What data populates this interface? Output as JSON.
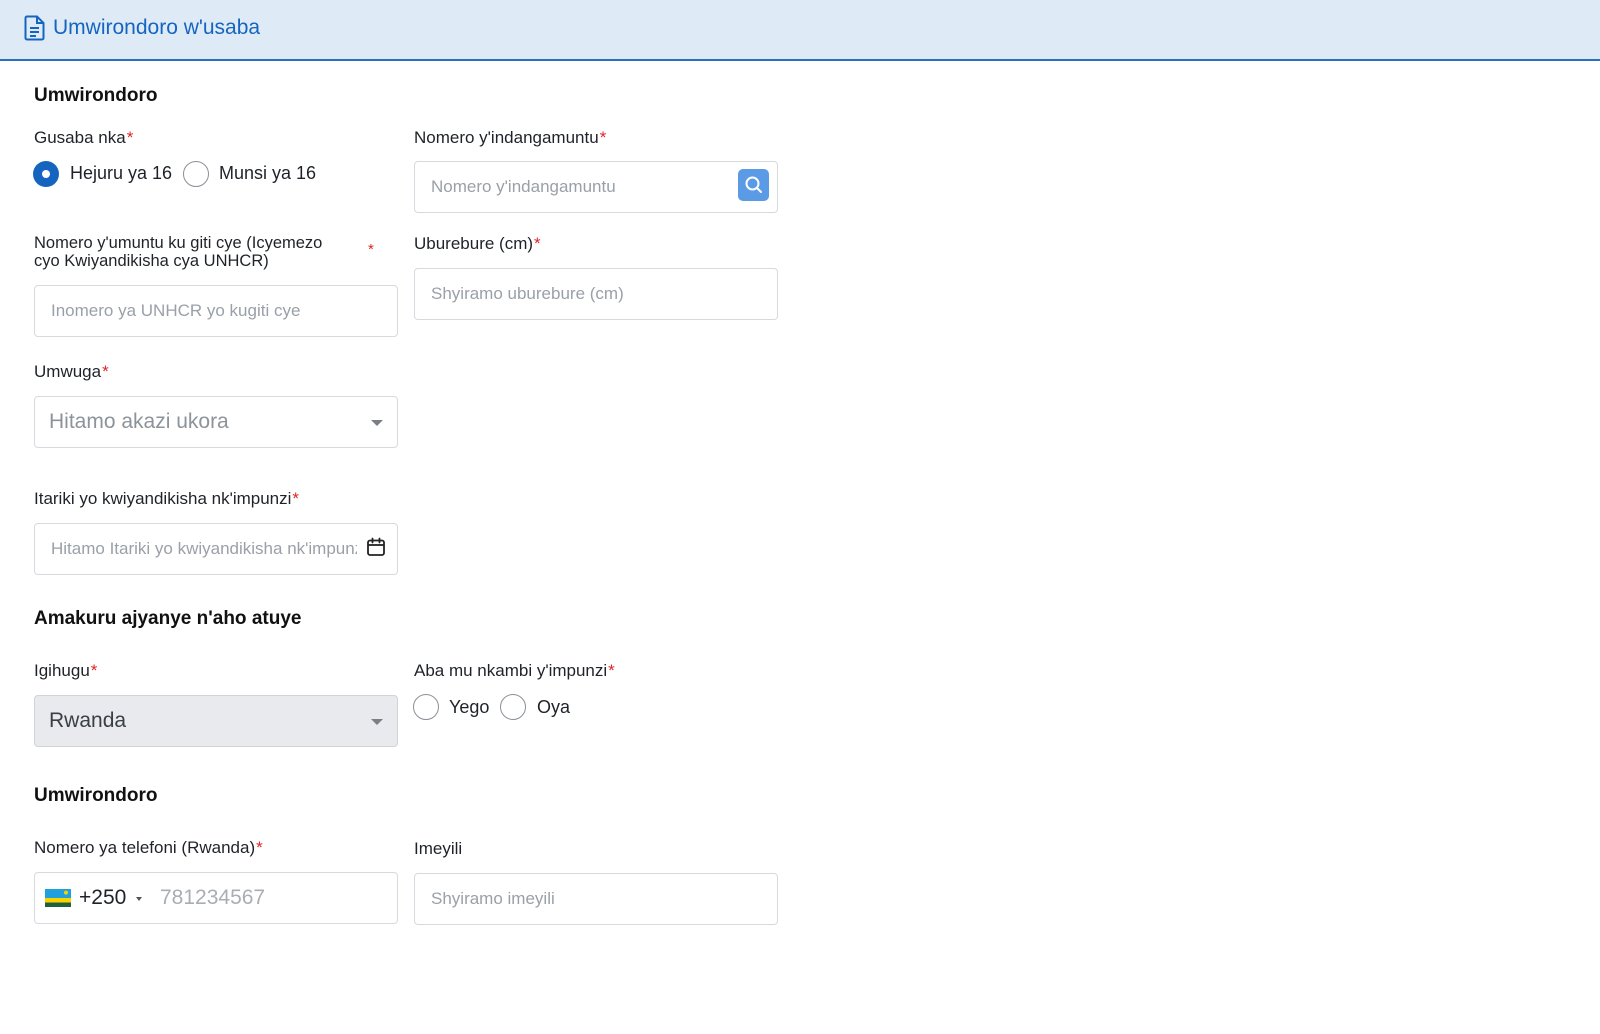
{
  "header": {
    "title": "Umwirondoro w'usaba",
    "icon": "document-icon"
  },
  "profile_section": {
    "title": "Umwirondoro",
    "applicant_type": {
      "label": "Gusaba nka",
      "required": "*",
      "options": [
        {
          "label": "Hejuru ya 16",
          "checked": true
        },
        {
          "label": "Munsi ya 16",
          "checked": false
        }
      ]
    },
    "id_number": {
      "label": "Nomero y'indangamuntu",
      "required": "*",
      "placeholder": "Nomero y'indangamuntu"
    },
    "unhcr": {
      "label_line1": "Nomero y'umuntu ku giti cye (Icyemezo",
      "label_line2": "cyo Kwiyandikisha cya UNHCR)",
      "required": "*",
      "placeholder": "Inomero ya UNHCR yo kugiti cye"
    },
    "height": {
      "label": "Uburebure (cm)",
      "required": "*",
      "placeholder": "Shyiramo uburebure (cm)"
    },
    "occupation": {
      "label": "Umwuga",
      "required": "*",
      "placeholder": "Hitamo akazi ukora"
    },
    "refugee_date": {
      "label": "Itariki yo kwiyandikisha nk'impunzi",
      "required": "*",
      "placeholder": "Hitamo Itariki yo kwiyandikisha nk'impunzi"
    }
  },
  "residence_section": {
    "title": "Amakuru ajyanye n'aho atuye",
    "country": {
      "label": "Igihugu",
      "required": "*",
      "value": "Rwanda"
    },
    "camp": {
      "label": "Aba mu nkambi y'impunzi",
      "required": "*",
      "options": [
        {
          "label": "Yego",
          "checked": false
        },
        {
          "label": "Oya",
          "checked": false
        }
      ]
    }
  },
  "contact_section": {
    "title": "Umwirondoro",
    "phone": {
      "label": "Nomero ya telefoni (Rwanda)",
      "required": "*",
      "dial_code": "+250",
      "placeholder": "781234567"
    },
    "email": {
      "label": "Imeyili",
      "placeholder": "Shyiramo imeyili"
    }
  },
  "colors": {
    "accent": "#1565c0",
    "header_bg": "#deebf7",
    "required": "#e02424"
  }
}
